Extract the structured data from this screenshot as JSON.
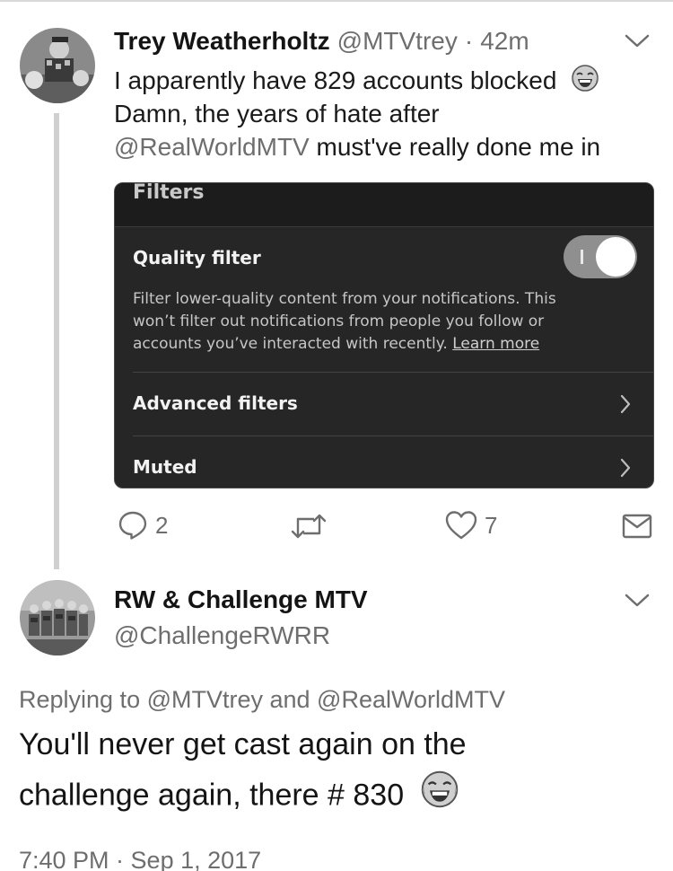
{
  "tweet": {
    "author_name": "Trey Weatherholtz",
    "author_handle": "@MTVtrey",
    "separator": "·",
    "time_ago": "42m",
    "line1": "I apparently have 829 accounts blocked",
    "line2": "Damn, the years of hate after",
    "line3_mention": "@RealWorldMTV",
    "line3_rest": "must've really done me in",
    "emoji": "face-with-tears-of-joy-icon",
    "embedded_screenshot": {
      "title": "Filters",
      "quality_filter_label": "Quality filter",
      "quality_filter_on": true,
      "description_line1": "Filter lower-quality content from your notifications. This",
      "description_line2": "won’t filter out notifications from people you follow or",
      "description_line3": "accounts you’ve interacted with recently.",
      "learn_more": "Learn more",
      "advanced_filters_label": "Advanced filters",
      "muted_label": "Muted"
    },
    "actions": {
      "reply_count": "2",
      "retweet_count": "",
      "like_count": "7"
    }
  },
  "reply": {
    "author_name": "RW & Challenge MTV",
    "author_handle": "@ChallengeRWRR",
    "replying_to": "Replying to @MTVtrey and @RealWorldMTV",
    "line1": "You'll never get cast again on the",
    "line2": "challenge again, there # 830",
    "emoji": "face-with-tears-of-joy-icon",
    "timestamp": "7:40 PM · Sep 1, 2017"
  }
}
